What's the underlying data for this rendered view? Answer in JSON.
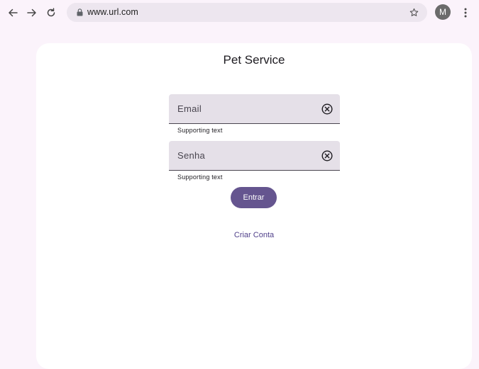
{
  "browser": {
    "url": "www.url.com",
    "avatar_letter": "M"
  },
  "page": {
    "title": "Pet Service"
  },
  "form": {
    "email": {
      "placeholder": "Email",
      "supporting": "Supporting text"
    },
    "password": {
      "placeholder": "Senha",
      "supporting": "Supporting text"
    },
    "submit_label": "Entrar",
    "create_account_label": "Criar Conta"
  },
  "colors": {
    "primary": "#65558f",
    "field_bg": "#e5e0e8",
    "page_bg": "#fbf3fb"
  }
}
